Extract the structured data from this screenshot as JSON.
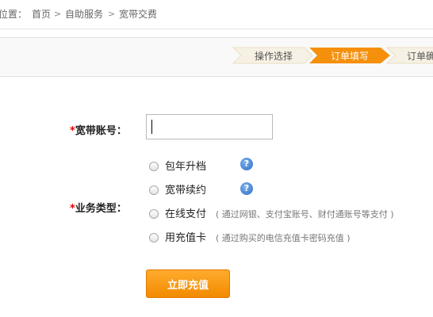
{
  "breadcrumb": {
    "prefix": "位置：",
    "home": "首页",
    "separator": ">",
    "self_service": "自助服务",
    "current": "宽带交费"
  },
  "steps": {
    "items": [
      "操作选择",
      "订单填写",
      "订单确"
    ],
    "active_color": "#f5900c",
    "inactive_color": "#f6f1e4"
  },
  "form": {
    "required_mark": "*",
    "account_label": "宽带账号：",
    "account_value": "",
    "type_label": "业务类型：",
    "options": [
      {
        "label": "包年升档",
        "note": ""
      },
      {
        "label": "宽带续约",
        "note": ""
      },
      {
        "label": "在线支付",
        "note": "( 通过网银、支付宝账号、财付通账号等支付 )"
      },
      {
        "label": "用充值卡",
        "note": "( 通过购买的电信充值卡密码充值 )"
      }
    ],
    "help_icon_text": "?",
    "submit_label": "立即充值"
  },
  "colors": {
    "accent": "#f28a00",
    "required": "#e60000",
    "help_icon": "#2c6cc4"
  },
  "icons": {
    "help": "question-circle-icon",
    "breadcrumb_separator": "chevron-right-icon"
  }
}
